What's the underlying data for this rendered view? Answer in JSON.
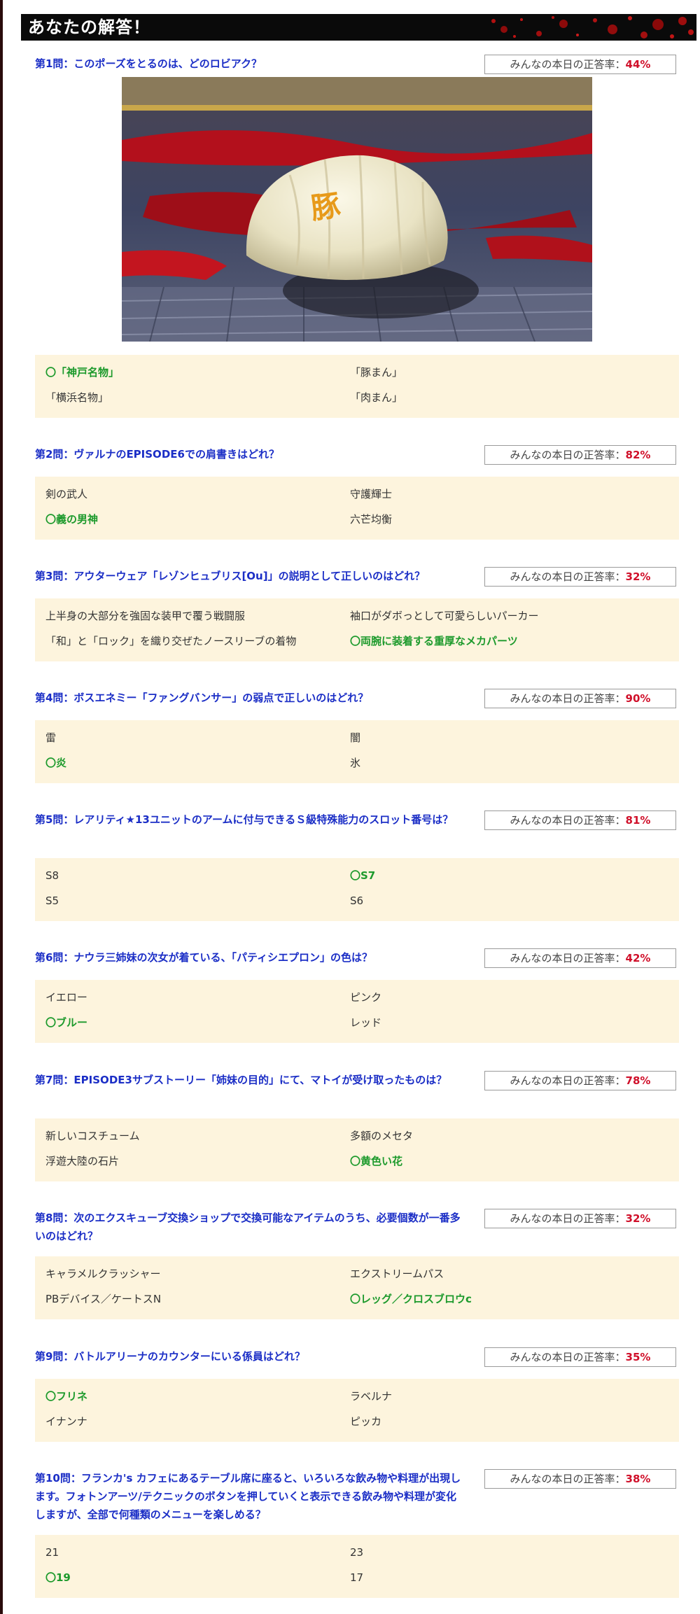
{
  "header": {
    "title": "あなたの解答！"
  },
  "rate_label": "みんなの本日の正答率：",
  "questions": [
    {
      "text": "第1問：このポーズをとるのは、どのロビアク？",
      "rate": "44%",
      "image_alt": "",
      "choices": [
        "〇「神戸名物」",
        "「豚まん」",
        "「横浜名物」",
        "「肉まん」"
      ],
      "correct_index": 0
    },
    {
      "text": "第2問：ヴァルナのEPISODE6での肩書きはどれ？",
      "rate": "82%",
      "choices": [
        "剣の武人",
        "守護輝士",
        "〇義の男神",
        "六芒均衡"
      ],
      "correct_index": 2
    },
    {
      "text": "第3問：アウターウェア「レゾンヒュブリス[Ou]」の説明として正しいのはどれ？",
      "rate": "32%",
      "choices": [
        "上半身の大部分を強固な装甲で覆う戦闘服",
        "袖口がダボっとして可愛らしいパーカー",
        "「和」と「ロック」を織り交ぜたノースリーブの着物",
        "〇両腕に装着する重厚なメカパーツ"
      ],
      "correct_index": 3
    },
    {
      "text": "第4問：ボスエネミー「ファングバンサー」の弱点で正しいのはどれ？",
      "rate": "90%",
      "choices": [
        "雷",
        "闇",
        "〇炎",
        "氷"
      ],
      "correct_index": 2
    },
    {
      "text": "第5問：レアリティ★13ユニットのアームに付与できるＳ級特殊能力のスロット番号は？",
      "rate": "81%",
      "choices": [
        "S8",
        "〇S7",
        "S5",
        "S6"
      ],
      "correct_index": 1
    },
    {
      "text": "第6問：ナウラ三姉妹の次女が着ている、「パティシエプロン」の色は？",
      "rate": "42%",
      "choices": [
        "イエロー",
        "ピンク",
        "〇ブルー",
        "レッド"
      ],
      "correct_index": 2
    },
    {
      "text": "第7問：EPISODE3サブストーリー「姉妹の目的」にて、マトイが受け取ったものは？",
      "rate": "78%",
      "choices": [
        "新しいコスチューム",
        "多額のメセタ",
        "浮遊大陸の石片",
        "〇黄色い花"
      ],
      "correct_index": 3
    },
    {
      "text": "第8問：次のエクスキューブ交換ショップで交換可能なアイテムのうち、必要個数が一番多いのはどれ？",
      "rate": "32%",
      "choices": [
        "キャラメルクラッシャー",
        "エクストリームパス",
        "PBデバイス／ケートスN",
        "〇レッグ／クロスブロウc"
      ],
      "correct_index": 3
    },
    {
      "text": "第9問：バトルアリーナのカウンターにいる係員はどれ？",
      "rate": "35%",
      "choices": [
        "〇フリネ",
        "ラベルナ",
        "イナンナ",
        "ピッカ"
      ],
      "correct_index": 0
    },
    {
      "text": "第10問：フランカ's カフェにあるテーブル席に座ると、いろいろな飲み物や料理が出現します。フォトンアーツ/テクニックのボタンを押していくと表示できる飲み物や料理が変化しますが、全部で何種類のメニューを楽しめる？",
      "rate": "38%",
      "choices": [
        "21",
        "23",
        "〇19",
        "17"
      ],
      "correct_index": 2
    }
  ],
  "colors": {
    "question_text": "#1b2ec6",
    "rate_value": "#d0102a",
    "correct_choice": "#1d9a2c",
    "choice_bg": "#fdf4dd",
    "header_bg": "#0a0a0a"
  }
}
